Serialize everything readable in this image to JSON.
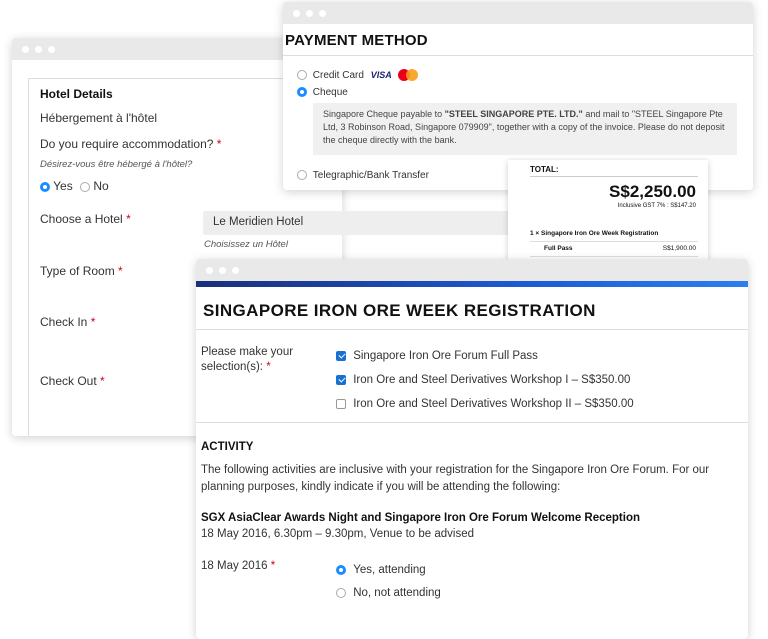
{
  "hotel": {
    "title": "Hotel Details",
    "subtitle_fr": "Hébergement à l'hôtel",
    "accommodation_q": "Do you require accommodation?",
    "accommodation_q_fr": "Désirez-vous être hébergé à l'hôtel?",
    "yes": "Yes",
    "no": "No",
    "choose_hotel": "Choose a Hotel",
    "hotel_value": "Le Meridien Hotel",
    "hotel_hint_fr": "Choisissez un Hôtel",
    "room_type": "Type of Room",
    "check_in": "Check In",
    "check_out": "Check Out",
    "required_mark": "*"
  },
  "payment": {
    "title": "PAYMENT METHOD",
    "credit_card": "Credit Card",
    "visa": "VISA",
    "cheque": "Cheque",
    "cheque_note_prefix": "Singapore Cheque payable to ",
    "cheque_payee": "\"STEEL SINGAPORE PTE. LTD.\"",
    "cheque_note_suffix": " and mail to \"STEEL Singapore Pte Ltd, 3 Robinson Road, Singapore 079909\", together with a copy of the invoice. Please do not deposit the cheque directly with the bank.",
    "transfer": "Telegraphic/Bank Transfer",
    "colors": {
      "mc_red": "#eb001b",
      "mc_orange": "#f79e1b"
    }
  },
  "total": {
    "label": "TOTAL:",
    "amount": "S$2,250.00",
    "gst": "Inclusive GST 7% : S$147.20",
    "line_item": "1 × Singapore Iron Ore Week Registration",
    "pass_label": "Full Pass",
    "pass_price": "S$1,900.00"
  },
  "registration": {
    "title": "SINGAPORE IRON ORE WEEK REGISTRATION",
    "selection_label_1": "Please make your",
    "selection_label_2": "selection(s):",
    "options": [
      {
        "label": "Singapore Iron Ore Forum Full Pass",
        "checked": true
      },
      {
        "label": "Iron Ore and Steel Derivatives Workshop I – S$350.00",
        "checked": true
      },
      {
        "label": "Iron Ore and Steel Derivatives Workshop II – S$350.00",
        "checked": false
      }
    ],
    "activity_heading": "ACTIVITY",
    "activity_desc_1": "The following activities are inclusive with your registration for the Singapore Iron Ore Forum. For our",
    "activity_desc_2": "planning purposes, kindly indicate if you will be attending the following:",
    "event_title": "SGX AsiaClear Awards Night and Singapore Iron Ore Forum Welcome Reception",
    "event_time": "18 May 2016, 6.30pm – 9.30pm, Venue to be advised",
    "date_label": "18 May 2016",
    "attend_yes": "Yes, attending",
    "attend_no": "No, not attending",
    "accent": "#1d5bd6"
  }
}
